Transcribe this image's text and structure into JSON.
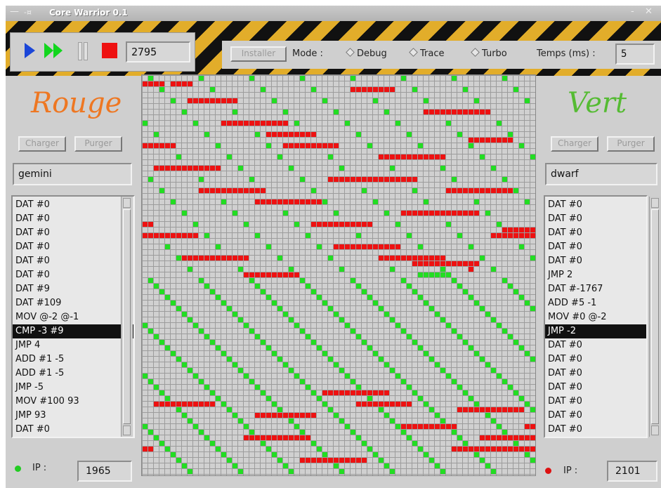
{
  "window": {
    "title": "Core Warrior 0.1"
  },
  "toolbar": {
    "cycle_count": "2795",
    "install_label": "Installer",
    "mode_label": "Mode :",
    "mode_options": [
      "Debug",
      "Trace",
      "Turbo"
    ],
    "time_label": "Temps (ms) :",
    "time_value": "5"
  },
  "left_panel": {
    "team_name": "Rouge",
    "load_label": "Charger",
    "purge_label": "Purger",
    "program_name": "gemini",
    "instructions": [
      "DAT #0",
      "DAT #0",
      "DAT #0",
      "DAT #0",
      "DAT #0",
      "DAT #0",
      "DAT #9",
      "DAT #109",
      "MOV @-2 @-1",
      "CMP -3 #9",
      "JMP 4",
      "ADD #1 -5",
      "ADD #1 -5",
      "JMP -5",
      "MOV #100 93",
      "JMP 93",
      "DAT #0"
    ],
    "selected_index": 9,
    "ip_label": "IP :",
    "ip_value": "1965",
    "indicator_color": "#22cc22"
  },
  "right_panel": {
    "team_name": "Vert",
    "load_label": "Charger",
    "purge_label": "Purger",
    "program_name": "dwarf",
    "instructions": [
      "DAT #0",
      "DAT #0",
      "DAT #0",
      "DAT #0",
      "DAT #0",
      "JMP 2",
      "DAT #-1767",
      "ADD #5 -1",
      "MOV #0 @-2",
      "JMP -2",
      "DAT #0",
      "DAT #0",
      "DAT #0",
      "DAT #0",
      "DAT #0",
      "DAT #0",
      "DAT #0"
    ],
    "selected_index": 9,
    "ip_label": "IP :",
    "ip_value": "2101",
    "indicator_color": "#dd1111"
  },
  "colors": {
    "red": "#ee1111",
    "green": "#22dd22",
    "grid_bg": "#d0d0d0",
    "hazard_yellow": "#e2ad2a"
  }
}
